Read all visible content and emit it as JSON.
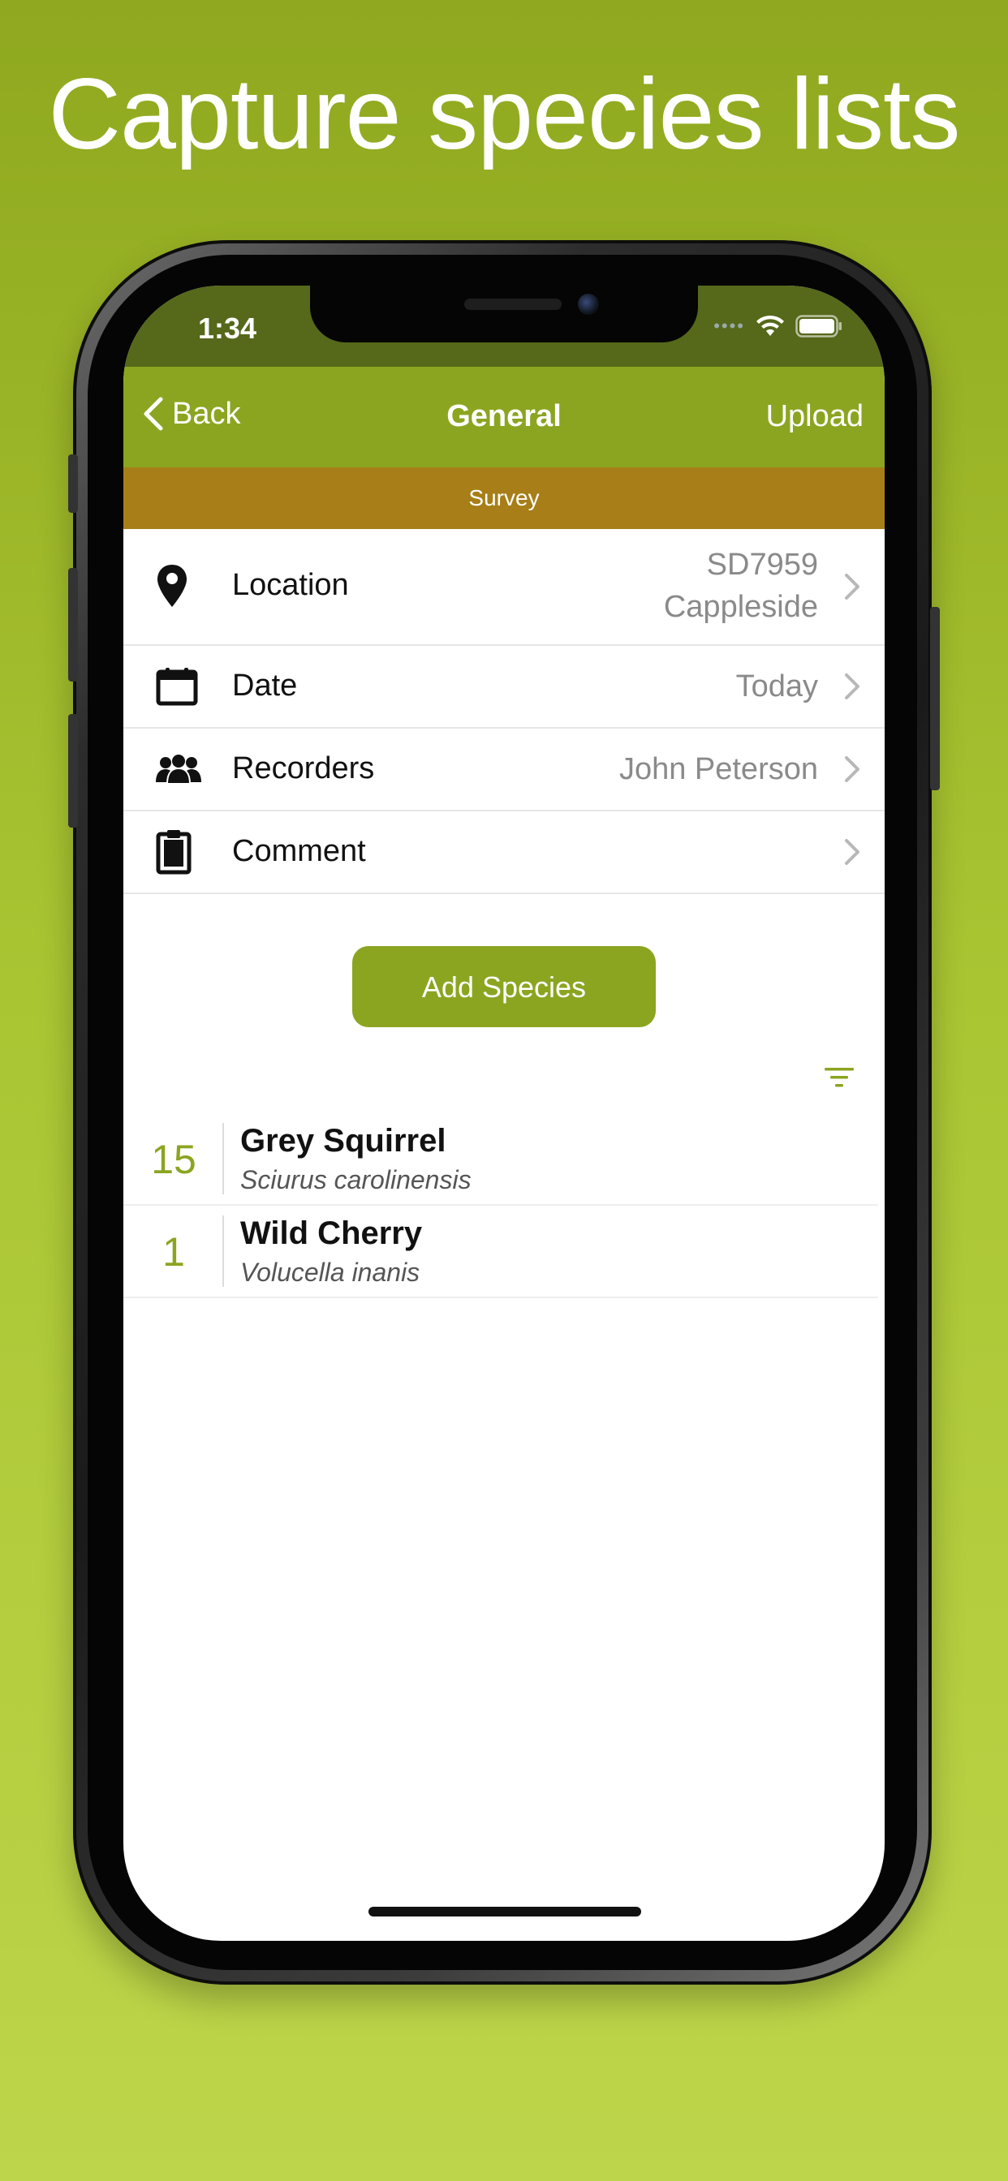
{
  "headline": "Capture species lists",
  "status_bar": {
    "time": "1:34"
  },
  "nav": {
    "back_label": "Back",
    "title": "General",
    "upload_label": "Upload"
  },
  "subheader": "Survey",
  "rows": [
    {
      "label": "Location",
      "value_line1": "SD7959",
      "value_line2": "Cappleside",
      "icon": "location-pin-icon"
    },
    {
      "label": "Date",
      "value": "Today",
      "icon": "calendar-icon"
    },
    {
      "label": "Recorders",
      "value": "John Peterson",
      "icon": "people-icon"
    },
    {
      "label": "Comment",
      "value": "",
      "icon": "clipboard-icon"
    }
  ],
  "add_species_label": "Add Species",
  "species": [
    {
      "count": "15",
      "name": "Grey Squirrel",
      "latin": "Sciurus carolinensis"
    },
    {
      "count": "1",
      "name": "Wild Cherry",
      "latin": "Volucella inanis"
    }
  ],
  "colors": {
    "accent": "#8ba521",
    "survey_bar": "#a77e17",
    "status_bar": "#56681a"
  }
}
